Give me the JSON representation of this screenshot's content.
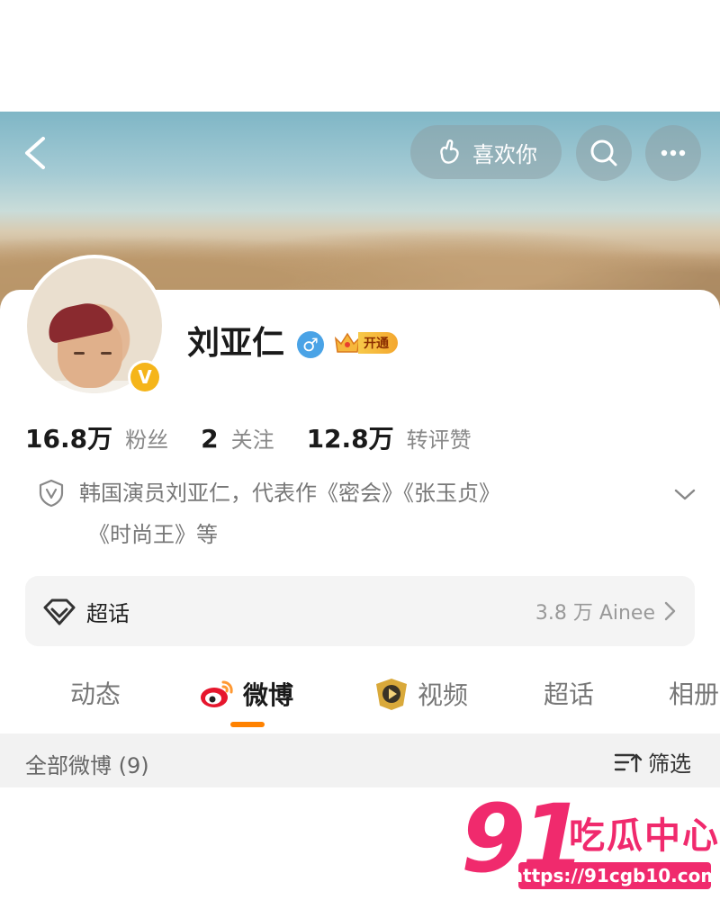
{
  "header": {
    "like_label": "喜欢你"
  },
  "profile": {
    "name": "刘亚仁",
    "gender_symbol": "♂",
    "vip_label": "开通",
    "verified_mark": "V"
  },
  "stats": [
    {
      "value": "16.8万",
      "label": "粉丝"
    },
    {
      "value": "2",
      "label": "关注"
    },
    {
      "value": "12.8万",
      "label": "转评赞"
    }
  ],
  "bio": {
    "line1": "韩国演员刘亚仁，代表作《密会》《张玉贞》",
    "line2": "《时尚王》等"
  },
  "chaohua": {
    "label": "超话",
    "value": "3.8 万 Ainee"
  },
  "tabs": [
    {
      "label": "动态"
    },
    {
      "label": "微博"
    },
    {
      "label": "视频"
    },
    {
      "label": "超话"
    },
    {
      "label": "相册"
    }
  ],
  "filter_bar": {
    "all_label": "全部微博 (9)",
    "filter_label": "筛选"
  },
  "watermark": {
    "number": "91",
    "text": "吃瓜中心",
    "url": "https://91cgb10.com"
  },
  "colors": {
    "accent": "#ff8200",
    "watermark": "#f02a6d",
    "verified": "#f5b51a",
    "gender": "#4aa3e6"
  }
}
